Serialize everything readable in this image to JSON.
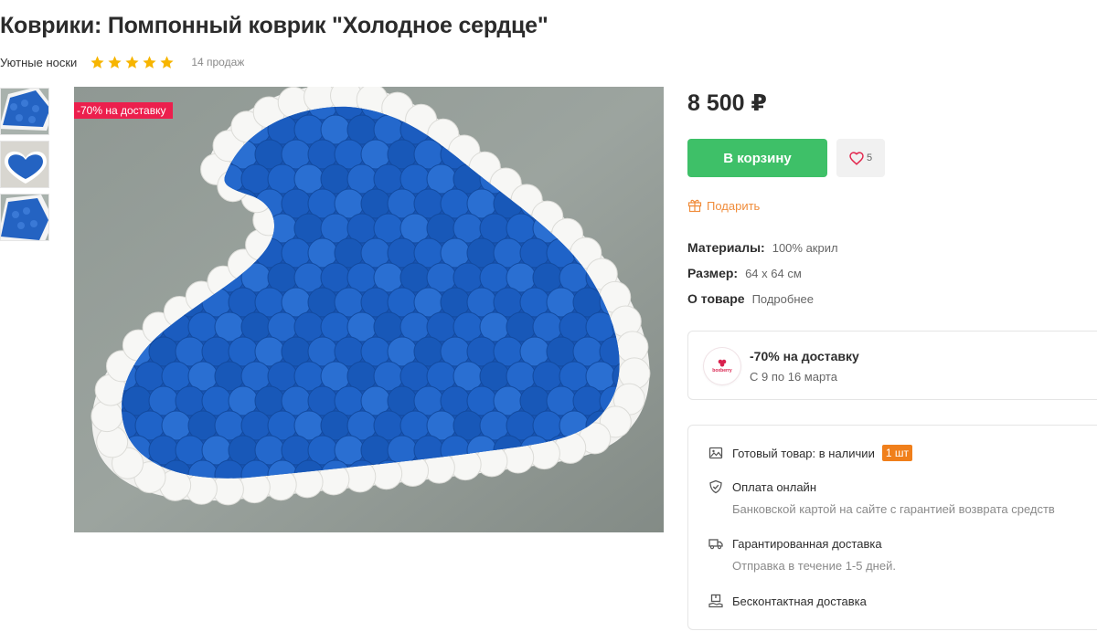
{
  "product": {
    "title": "Коврики: Помпонный коврик \"Холодное сердце\"",
    "shop_name": "Уютные носки",
    "rating_stars": 5,
    "sales": "14 продаж",
    "promo_badge": "-70% на доставку",
    "price": "8 500 ₽"
  },
  "actions": {
    "cart_label": "В корзину",
    "favorites_count": "5",
    "gift_label": "Подарить"
  },
  "attributes": [
    {
      "key": "Материалы:",
      "value": "100% акрил"
    },
    {
      "key": "Размер:",
      "value": "64 х 64 см"
    },
    {
      "key": "О товаре",
      "value": "Подробнее"
    }
  ],
  "delivery_promo": {
    "title": "-70% на доставку",
    "dates": "С 9 по 16 марта",
    "logo_text": "boxberry"
  },
  "info": {
    "stock_label": "Готовый товар: в наличии",
    "stock_qty": "1 шт",
    "payment_title": "Оплата онлайн",
    "payment_sub": "Банковской картой на сайте с гарантией возврата средств",
    "shipping_title": "Гарантированная доставка",
    "shipping_sub": "Отправка в течение 1-5 дней.",
    "contactless": "Бесконтактная доставка"
  },
  "colors": {
    "accent_green": "#3ec068",
    "promo_red": "#ec1f4d",
    "gift_orange": "#f08d3c",
    "star_gold": "#f7b500",
    "badge_orange": "#f07f1b",
    "pompom_blue": "#1d5fbf"
  },
  "icons": {
    "rating": "star-icon",
    "favorite": "heart-icon",
    "gift": "gift-icon",
    "stock": "image-icon",
    "payment": "shield-check-icon",
    "shipping": "truck-icon",
    "contactless": "package-hand-icon"
  }
}
